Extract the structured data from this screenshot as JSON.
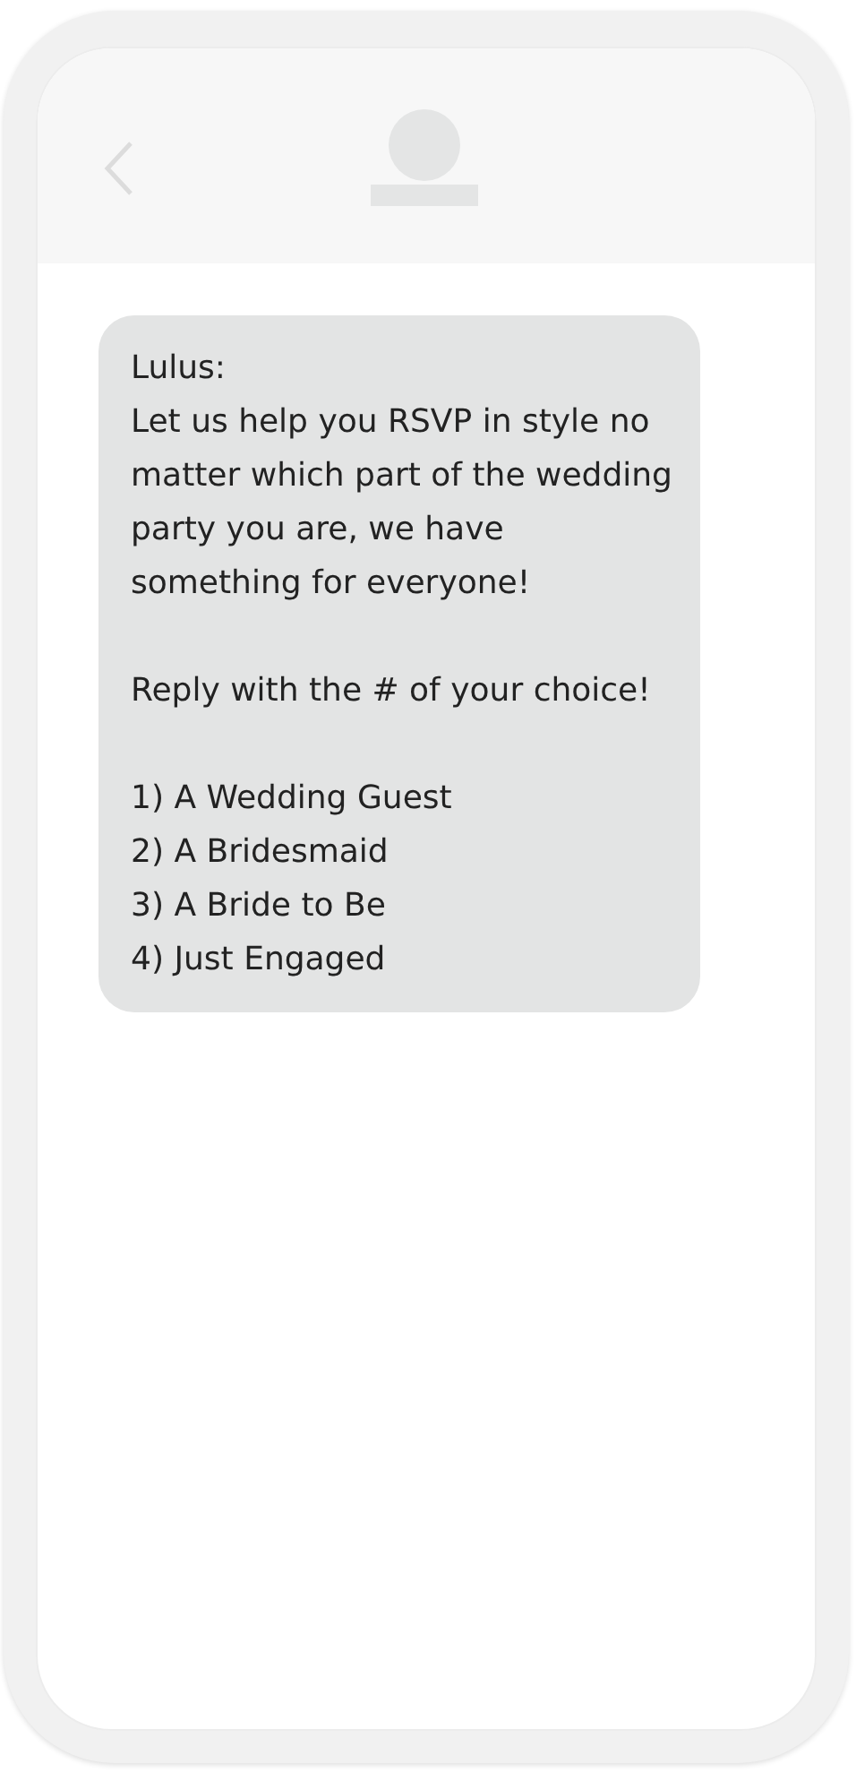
{
  "message": {
    "sender": "Lulus:",
    "paragraphs": [
      "Let us help you RSVP in style no matter which part of the wedding party you are, we have something for everyone!",
      "Reply with the # of your choice!"
    ],
    "options": [
      "1) A Wedding Guest",
      "2) A Bridesmaid",
      "3) A Bride to Be",
      "4) Just Engaged"
    ]
  }
}
